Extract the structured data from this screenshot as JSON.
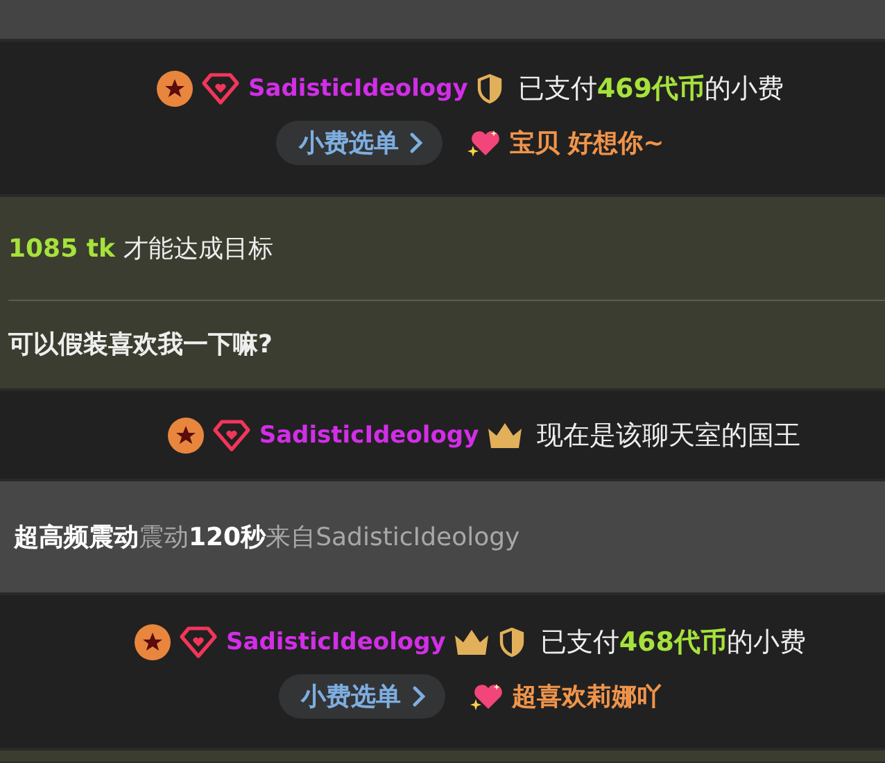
{
  "messages": [
    {
      "kind": "tip",
      "user": "SadisticIdeology",
      "crown": false,
      "shield": true,
      "text_before": "已支付",
      "amount": "469代币",
      "text_after": "的小费",
      "menu_button": "小费选单",
      "note": "宝贝 好想你~"
    },
    {
      "kind": "goal",
      "amount": "1085 tk",
      "goal_text": "才能达成目标",
      "subject": "可以假装喜欢我一下嘛?"
    },
    {
      "kind": "king",
      "user": "SadisticIdeology",
      "crown": true,
      "shield": false,
      "text": "现在是该聊天室的国王"
    },
    {
      "kind": "vibration",
      "level_name": "超高频震动",
      "label": "震动",
      "duration": "120秒",
      "source": "来自SadisticIdeology"
    },
    {
      "kind": "tip",
      "user": "SadisticIdeology",
      "crown": true,
      "shield": true,
      "text_before": "已支付",
      "amount": "468代币",
      "text_after": "的小费",
      "menu_button": "小费选单",
      "note": "超喜欢莉娜吖"
    }
  ]
}
